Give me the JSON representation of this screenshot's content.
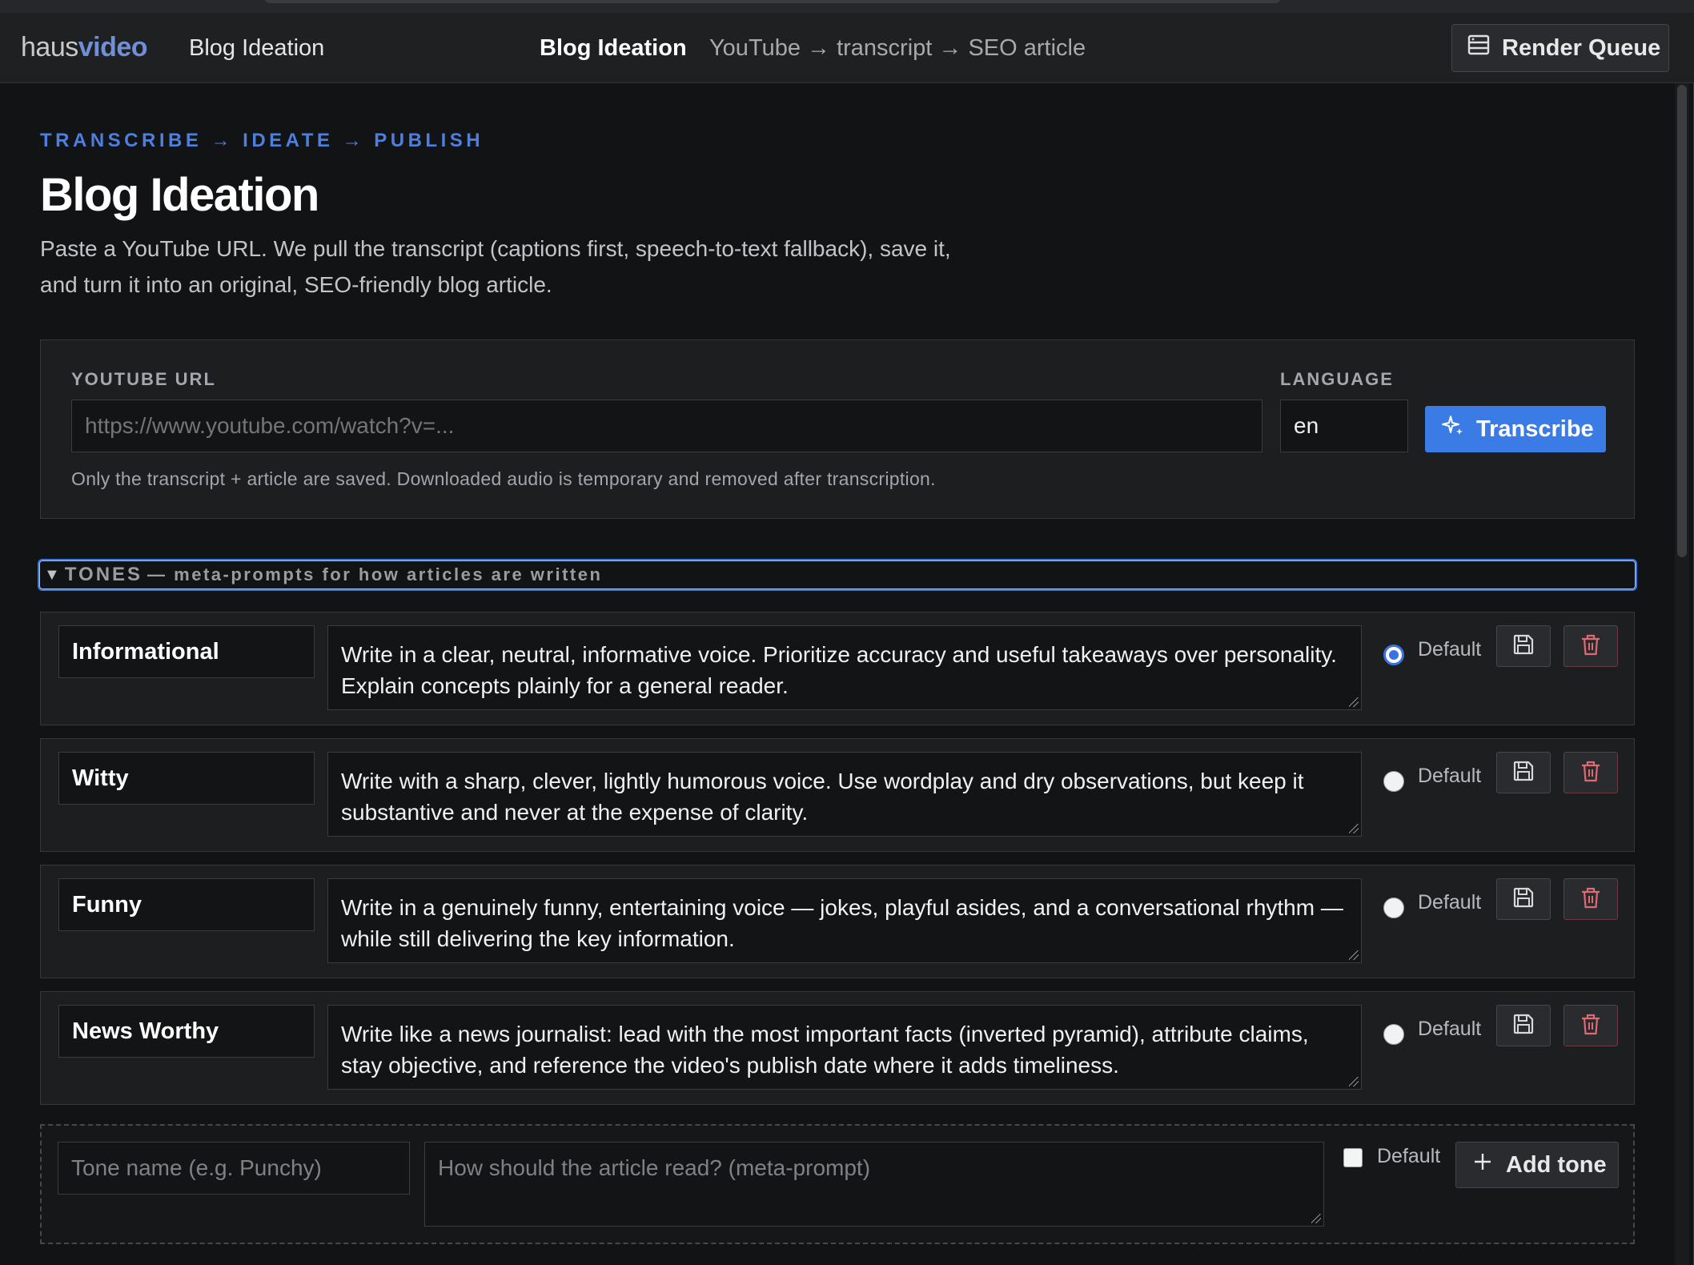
{
  "nav": {
    "logo_part1": "haus",
    "logo_part2": "video",
    "link": "Blog Ideation",
    "center_title": "Blog Ideation",
    "center_sub": "YouTube → transcript → SEO article",
    "render_queue": "Render Queue"
  },
  "page": {
    "eyebrow": "TRANSCRIBE → IDEATE → PUBLISH",
    "title": "Blog Ideation",
    "description": "Paste a YouTube URL. We pull the transcript (captions first, speech-to-text fallback), save it, and turn it into an original, SEO-friendly blog article."
  },
  "form": {
    "url_label": "YOUTUBE URL",
    "url_placeholder": "https://www.youtube.com/watch?v=...",
    "language_label": "LANGUAGE",
    "language_value": "en",
    "transcribe_label": "Transcribe",
    "note": "Only the transcript + article are saved. Downloaded audio is temporary and removed after transcription."
  },
  "tones": {
    "header_title": "TONES",
    "header_sub": "— meta-prompts for how articles are written",
    "default_label": "Default",
    "items": [
      {
        "name": "Informational",
        "prompt": "Write in a clear, neutral, informative voice. Prioritize accuracy and useful takeaways over personality. Explain concepts plainly for a general reader.",
        "is_default": true
      },
      {
        "name": "Witty",
        "prompt": "Write with a sharp, clever, lightly humorous voice. Use wordplay and dry observations, but keep it substantive and never at the expense of clarity.",
        "is_default": false
      },
      {
        "name": "Funny",
        "prompt": "Write in a genuinely funny, entertaining voice — jokes, playful asides, and a conversational rhythm — while still delivering the key information.",
        "is_default": false
      },
      {
        "name": "News Worthy",
        "prompt": "Write like a news journalist: lead with the most important facts (inverted pyramid), attribute claims, stay objective, and reference the video's publish date where it adds timeliness.",
        "is_default": false
      }
    ],
    "new": {
      "name_placeholder": "Tone name (e.g. Punchy)",
      "prompt_placeholder": "How should the article read? (meta-prompt)",
      "default_label": "Default",
      "add_label": "Add tone"
    }
  },
  "colors": {
    "accent": "#3a7be6",
    "eyebrow": "#4f7fdc",
    "background": "#121315",
    "panel": "#1d1e20"
  },
  "icons": [
    "queue-icon",
    "sparkle-icon",
    "save-icon",
    "trash-icon",
    "plus-icon"
  ]
}
